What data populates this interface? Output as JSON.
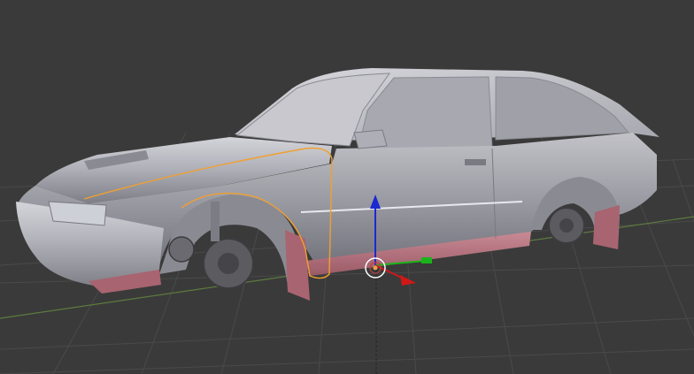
{
  "viewport": {
    "background": "#3a3a3a",
    "grid_color": "#4a4a4a",
    "grid_axis_x_color": "#6b3c3c",
    "grid_axis_y_color": "#4e7a3a",
    "selection_outline_color": "#f0a030"
  },
  "model": {
    "body_color": "#b4b4bc",
    "shadow_color": "#6a6a72",
    "rocker_color": "#c07884",
    "wheel_color": "#5c5c60",
    "window_color": "#9c9ca4"
  },
  "gizmo": {
    "x_axis_color": "#d01818",
    "y_axis_color": "#1ab41a",
    "z_axis_color": "#1a2ad0",
    "origin_color": "#e8a050"
  }
}
